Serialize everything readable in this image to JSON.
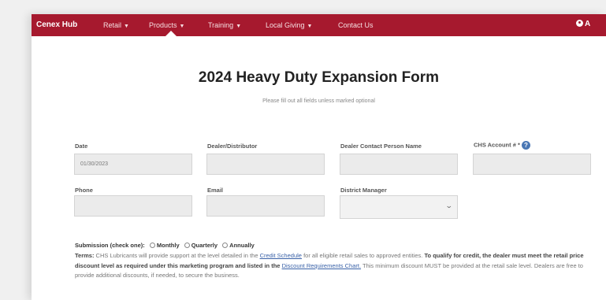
{
  "nav": {
    "brand": "Cenex Hub",
    "items": [
      {
        "label": "Retail",
        "caret": "▼"
      },
      {
        "label": "Products",
        "caret": "▼"
      },
      {
        "label": "Training",
        "caret": "▼"
      },
      {
        "label": "Local Giving",
        "caret": "▼"
      },
      {
        "label": "Contact Us"
      }
    ],
    "user_label": "A"
  },
  "form": {
    "title": "2024 Heavy Duty Expansion Form",
    "subtitle": "Please fill out all fields unless marked optional",
    "fields": {
      "date": {
        "label": "Date",
        "value": "01/30/2023"
      },
      "dealer": {
        "label": "Dealer/Distributor",
        "value": ""
      },
      "contact": {
        "label": "Dealer Contact Person Name",
        "value": ""
      },
      "account": {
        "label": "CHS Account # *",
        "value": "",
        "help": "?"
      },
      "phone": {
        "label": "Phone",
        "value": ""
      },
      "email": {
        "label": "Email",
        "value": ""
      },
      "manager": {
        "label": "District Manager",
        "selected": "",
        "chevron": "⌄"
      }
    },
    "submission": {
      "label": "Submission (check one):",
      "options": [
        "Monthly",
        "Quarterly",
        "Annually"
      ]
    },
    "terms": {
      "label": "Terms:",
      "text1": "CHS Lubricants will provide support at the level detailed in the",
      "link1": "Credit Schedule",
      "text2": "for all eligible retail sales to approved entities.",
      "bold": "To qualify for credit, the dealer must meet the retail price discount level as required under this marketing program and listed in the",
      "link2": "Discount Requirements Chart.",
      "text3": "This minimum discount MUST be provided at the retail sale level. Dealers are free to provide additional discounts, if needed, to secure the business."
    }
  }
}
